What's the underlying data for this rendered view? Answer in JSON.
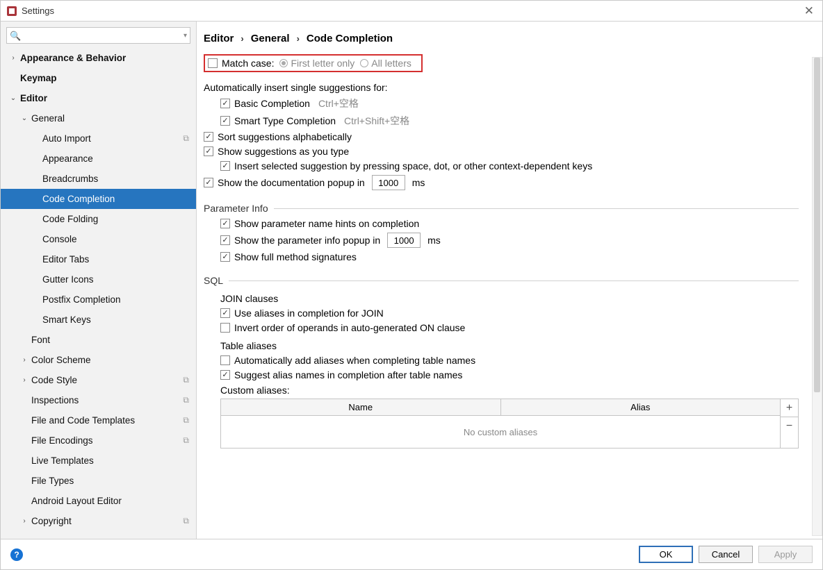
{
  "window": {
    "title": "Settings"
  },
  "sidebar": {
    "search_placeholder": "",
    "items": [
      {
        "label": "Appearance & Behavior",
        "arrow": "›",
        "bold": true,
        "cls": "ind1"
      },
      {
        "label": "Keymap",
        "arrow": "",
        "bold": true,
        "cls": "ind1 noarrow"
      },
      {
        "label": "Editor",
        "arrow": "⌄",
        "bold": true,
        "cls": "ind1"
      },
      {
        "label": "General",
        "arrow": "⌄",
        "bold": false,
        "cls": "ind2"
      },
      {
        "label": "Auto Import",
        "arrow": "",
        "bold": false,
        "cls": "ind3",
        "copy": true
      },
      {
        "label": "Appearance",
        "arrow": "",
        "bold": false,
        "cls": "ind3"
      },
      {
        "label": "Breadcrumbs",
        "arrow": "",
        "bold": false,
        "cls": "ind3"
      },
      {
        "label": "Code Completion",
        "arrow": "",
        "bold": false,
        "cls": "ind3",
        "selected": true
      },
      {
        "label": "Code Folding",
        "arrow": "",
        "bold": false,
        "cls": "ind3"
      },
      {
        "label": "Console",
        "arrow": "",
        "bold": false,
        "cls": "ind3"
      },
      {
        "label": "Editor Tabs",
        "arrow": "",
        "bold": false,
        "cls": "ind3"
      },
      {
        "label": "Gutter Icons",
        "arrow": "",
        "bold": false,
        "cls": "ind3"
      },
      {
        "label": "Postfix Completion",
        "arrow": "",
        "bold": false,
        "cls": "ind3"
      },
      {
        "label": "Smart Keys",
        "arrow": "",
        "bold": false,
        "cls": "ind3"
      },
      {
        "label": "Font",
        "arrow": "",
        "bold": false,
        "cls": "ind2 noarrow"
      },
      {
        "label": "Color Scheme",
        "arrow": "›",
        "bold": false,
        "cls": "ind2"
      },
      {
        "label": "Code Style",
        "arrow": "›",
        "bold": false,
        "cls": "ind2",
        "copy": true
      },
      {
        "label": "Inspections",
        "arrow": "",
        "bold": false,
        "cls": "ind2 noarrow",
        "copy": true
      },
      {
        "label": "File and Code Templates",
        "arrow": "",
        "bold": false,
        "cls": "ind2 noarrow",
        "copy": true
      },
      {
        "label": "File Encodings",
        "arrow": "",
        "bold": false,
        "cls": "ind2 noarrow",
        "copy": true
      },
      {
        "label": "Live Templates",
        "arrow": "",
        "bold": false,
        "cls": "ind2 noarrow"
      },
      {
        "label": "File Types",
        "arrow": "",
        "bold": false,
        "cls": "ind2 noarrow"
      },
      {
        "label": "Android Layout Editor",
        "arrow": "",
        "bold": false,
        "cls": "ind2 noarrow"
      },
      {
        "label": "Copyright",
        "arrow": "›",
        "bold": false,
        "cls": "ind2",
        "copy": true
      }
    ]
  },
  "breadcrumb": [
    "Editor",
    "General",
    "Code Completion"
  ],
  "main": {
    "match_case": {
      "label": "Match case:",
      "r1": "First letter only",
      "r2": "All letters"
    },
    "auto_insert_header": "Automatically insert single suggestions for:",
    "basic": {
      "label": "Basic Completion",
      "shortcut": "Ctrl+空格"
    },
    "smart_type": {
      "label": "Smart Type Completion",
      "shortcut": "Ctrl+Shift+空格"
    },
    "sort_alpha": "Sort suggestions alphabetically",
    "show_as_type": "Show suggestions as you type",
    "insert_selected": "Insert selected suggestion by pressing space, dot, or other context-dependent keys",
    "show_doc_prefix": "Show the documentation popup in",
    "show_doc_value": "1000",
    "show_doc_suffix": "ms",
    "parameter_info": {
      "title": "Parameter Info",
      "show_hints": "Show parameter name hints on completion",
      "popup_prefix": "Show the parameter info popup in",
      "popup_value": "1000",
      "popup_suffix": "ms",
      "full_sig": "Show full method signatures"
    },
    "sql": {
      "title": "SQL",
      "join_header": "JOIN clauses",
      "use_aliases_join": "Use aliases in completion for JOIN",
      "invert_on": "Invert order of operands in auto-generated ON clause",
      "table_aliases_header": "Table aliases",
      "auto_add_aliases": "Automatically add aliases when completing table names",
      "suggest_alias": "Suggest alias names in completion after table names",
      "custom_aliases_label": "Custom aliases:",
      "col_name": "Name",
      "col_alias": "Alias",
      "empty": "No custom aliases"
    }
  },
  "footer": {
    "ok": "OK",
    "cancel": "Cancel",
    "apply": "Apply"
  }
}
